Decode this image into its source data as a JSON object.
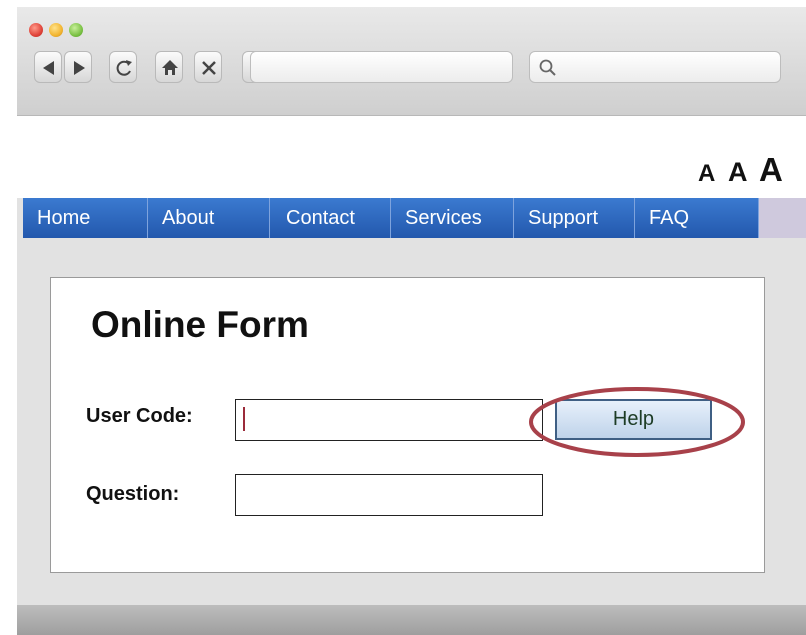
{
  "toolbar": {
    "new_tab_label": "+",
    "url_value": "",
    "search_value": ""
  },
  "text_size": {
    "small": "A",
    "medium": "A",
    "large": "A"
  },
  "nav": {
    "items": [
      {
        "label": "Home"
      },
      {
        "label": "About"
      },
      {
        "label": "Contact"
      },
      {
        "label": "Services"
      },
      {
        "label": "Support"
      },
      {
        "label": "FAQ"
      }
    ]
  },
  "form": {
    "title": "Online Form",
    "user_code_label": "User Code:",
    "user_code_value": "",
    "help_label": "Help",
    "question_label": "Question:",
    "question_value": ""
  },
  "colors": {
    "nav_blue": "#2f6cc4",
    "highlight_ring": "#a8414a"
  }
}
